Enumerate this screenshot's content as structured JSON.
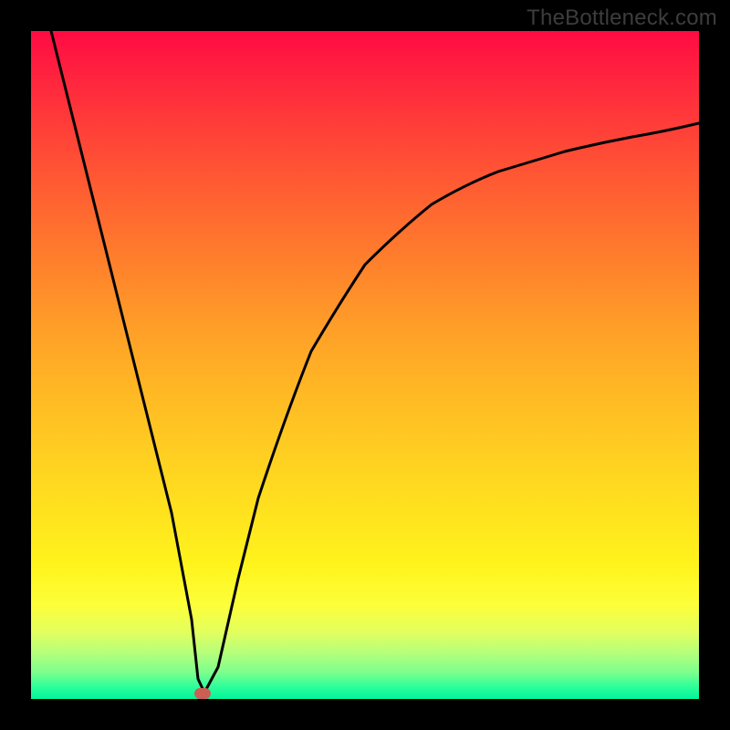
{
  "watermark": "TheBottleneck.com",
  "chart_data": {
    "type": "line",
    "title": "",
    "xlabel": "",
    "ylabel": "",
    "xlim": [
      0,
      100
    ],
    "ylim": [
      0,
      100
    ],
    "grid": false,
    "series": [
      {
        "name": "curve",
        "x": [
          3,
          6,
          9,
          12,
          15,
          18,
          21,
          24,
          25,
          26,
          28,
          31,
          34,
          38,
          42,
          46,
          50,
          55,
          60,
          65,
          70,
          75,
          80,
          85,
          90,
          95,
          100
        ],
        "values": [
          100,
          88,
          76,
          64,
          52,
          40,
          28,
          12,
          3,
          1,
          5,
          18,
          30,
          42,
          52,
          59,
          65,
          70,
          74,
          77,
          79.5,
          81.5,
          83,
          84.2,
          85,
          85.7,
          86.2
        ]
      }
    ],
    "min_marker": {
      "x": 25.5,
      "y": 0
    },
    "colors": {
      "curve": "#000000",
      "marker": "#cb5f55",
      "gradient_top": "#ff0b43",
      "gradient_bottom": "#00f59c"
    }
  }
}
